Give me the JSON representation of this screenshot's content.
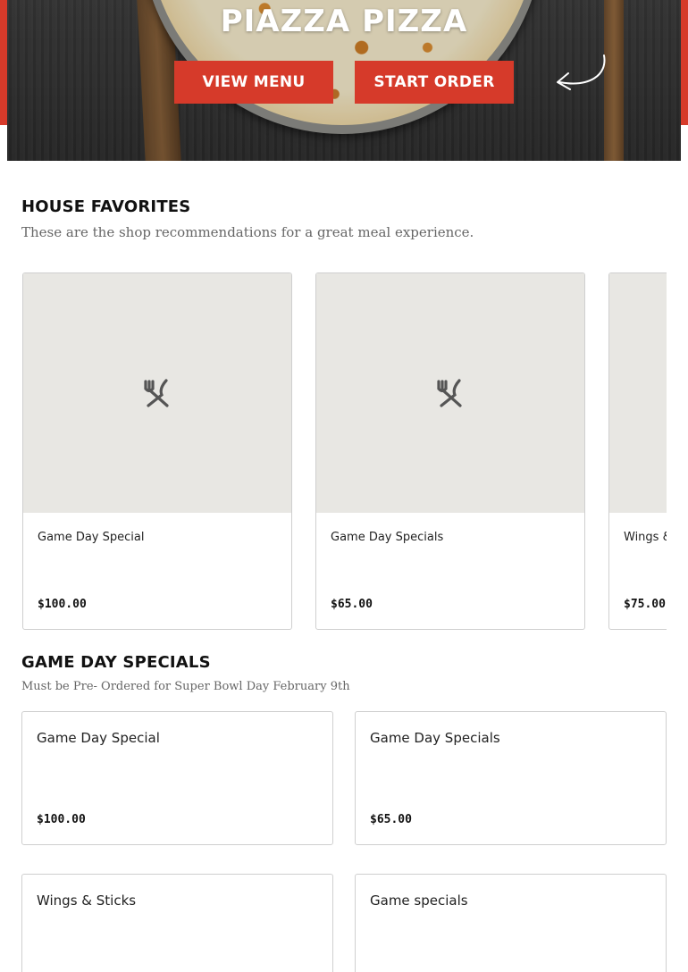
{
  "brand": {
    "accent": "#d63a2a"
  },
  "hero": {
    "title": "PIAZZA PIZZA",
    "view_menu_label": "VIEW MENU",
    "start_order_label": "START ORDER"
  },
  "house_favorites": {
    "title": "HOUSE FAVORITES",
    "subtitle": "These are the shop recommendations for a great meal experience.",
    "items": [
      {
        "name": "Game Day Special",
        "price": "$100.00",
        "icon": "utensils-icon"
      },
      {
        "name": "Game Day Specials",
        "price": "$65.00",
        "icon": "utensils-icon"
      },
      {
        "name": "Wings & Sticks",
        "price": "$75.00",
        "icon": "utensils-icon"
      }
    ]
  },
  "game_day_specials": {
    "title": "GAME DAY SPECIALS",
    "subtitle": "Must be Pre- Ordered for Super Bowl Day February 9th",
    "items": [
      {
        "name": "Game Day Special",
        "price": "$100.00"
      },
      {
        "name": "Game Day Specials",
        "price": "$65.00"
      },
      {
        "name": "Wings & Sticks",
        "price": ""
      },
      {
        "name": "Game specials",
        "price": ""
      }
    ]
  }
}
